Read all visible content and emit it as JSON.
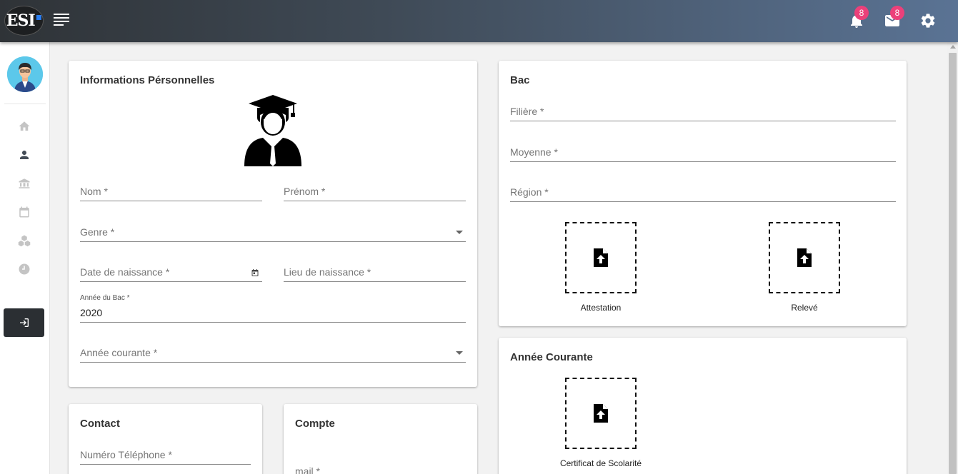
{
  "app": {
    "logo_text": "ESI"
  },
  "topbar": {
    "notifications_count": "8",
    "messages_count": "8"
  },
  "personal": {
    "title": "Informations Pérsonnelles",
    "nom_label": "Nom *",
    "prenom_label": "Prénom *",
    "genre_label": "Genre *",
    "date_naissance_label": "Date de naissance *",
    "lieu_naissance_label": "Lieu de naissance *",
    "annee_bac_label": "Année du Bac *",
    "annee_bac_value": "2020",
    "annee_courante_label": "Année courante *"
  },
  "contact": {
    "title": "Contact",
    "telephone_label": "Numéro Téléphone *"
  },
  "compte": {
    "title": "Compte",
    "mail_label": "mail *"
  },
  "bac": {
    "title": "Bac",
    "filiere_label": "Filière *",
    "moyenne_label": "Moyenne *",
    "region_label": "Région *",
    "attestation_label": "Attestation",
    "releve_label": "Relevé"
  },
  "annee_courante": {
    "title": "Année Courante",
    "certificat_label": "Certificat de Scolarité"
  },
  "colors": {
    "badge": "#ec407a",
    "logout_bg": "#2b2f33",
    "accent": "#2a7ff3"
  }
}
